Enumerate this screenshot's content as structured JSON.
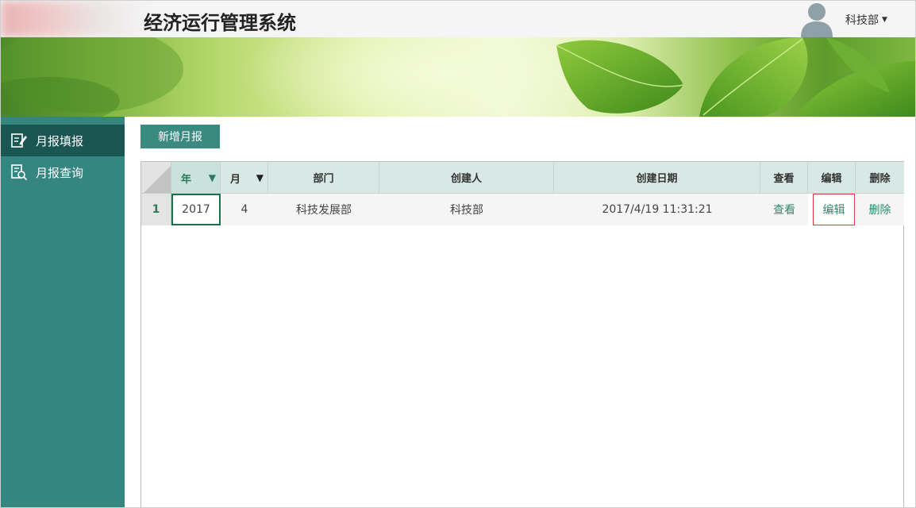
{
  "header": {
    "title": "经济运行管理系统",
    "user_name": "科技部"
  },
  "sidebar": {
    "items": [
      {
        "label": "月报填报",
        "icon": "edit-document-icon",
        "active": true
      },
      {
        "label": "月报查询",
        "icon": "search-document-icon",
        "active": false
      }
    ]
  },
  "toolbar": {
    "add_label": "新增月报"
  },
  "table": {
    "columns": [
      "年",
      "月",
      "部门",
      "创建人",
      "创建日期",
      "查看",
      "编辑",
      "删除"
    ],
    "rows": [
      {
        "index": "1",
        "year": "2017",
        "month": "4",
        "department": "科技发展部",
        "creator": "科技部",
        "created_date": "2017/4/19 11:31:21",
        "view": "查看",
        "edit": "编辑",
        "delete": "删除"
      }
    ]
  },
  "colors": {
    "sidebar": "#358580",
    "sidebar_active": "#1a5652",
    "button": "#3a8a80",
    "header_cell": "#d8e8e5",
    "link": "#2d8a6a",
    "highlight_border": "#d9393e"
  }
}
